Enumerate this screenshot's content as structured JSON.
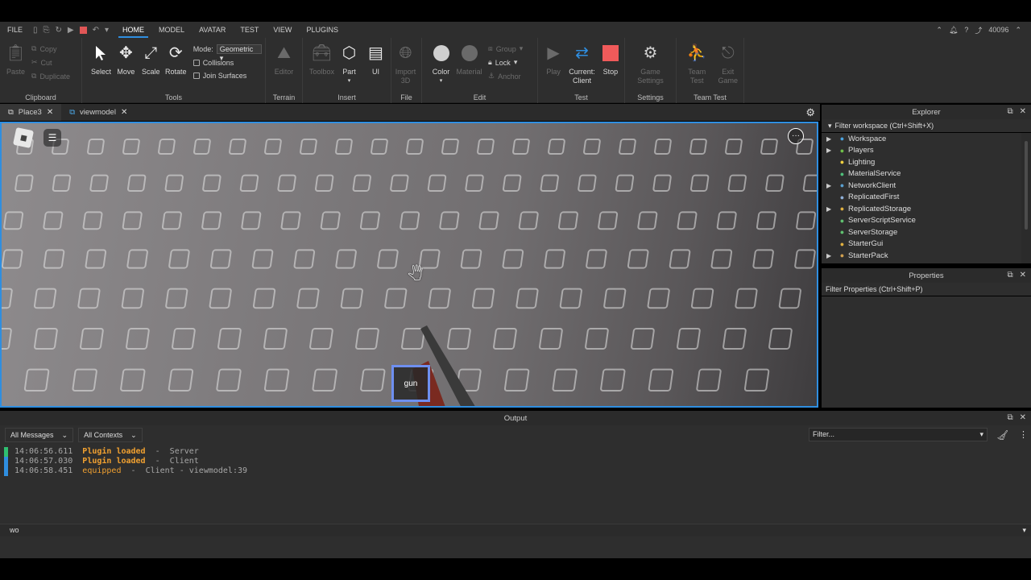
{
  "menubar": {
    "items": [
      "FILE",
      "HOME",
      "MODEL",
      "AVATAR",
      "TEST",
      "VIEW",
      "PLUGINS"
    ],
    "active": "HOME",
    "right_value": "40096"
  },
  "ribbon": {
    "clipboard": {
      "label": "Clipboard",
      "paste": "Paste",
      "copy": "Copy",
      "cut": "Cut",
      "duplicate": "Duplicate"
    },
    "tools": {
      "label": "Tools",
      "select": "Select",
      "move": "Move",
      "scale": "Scale",
      "rotate": "Rotate",
      "mode_label": "Mode:",
      "mode_value": "Geometric",
      "collisions": "Collisions",
      "join_surfaces": "Join Surfaces"
    },
    "terrain": {
      "label": "Terrain",
      "editor": "Editor"
    },
    "insert": {
      "label": "Insert",
      "toolbox": "Toolbox",
      "part": "Part",
      "ui": "UI"
    },
    "file": {
      "label": "File",
      "import3d": "Import 3D"
    },
    "edit": {
      "label": "Edit",
      "color": "Color",
      "material": "Material",
      "group": "Group",
      "lock": "Lock",
      "anchor": "Anchor"
    },
    "test": {
      "label": "Test",
      "play": "Play",
      "current_client": "Current: Client",
      "stop": "Stop"
    },
    "settings": {
      "label": "Settings",
      "game_settings": "Game Settings"
    },
    "team_test": {
      "label": "Team Test",
      "team_test": "Team Test",
      "exit_game": "Exit Game"
    }
  },
  "tabs": [
    {
      "label": "Place3",
      "active": true
    },
    {
      "label": "viewmodel",
      "active": false
    }
  ],
  "viewport": {
    "hotbar_label": "gun"
  },
  "explorer": {
    "title": "Explorer",
    "filter": "Filter workspace (Ctrl+Shift+X)",
    "items": [
      {
        "label": "Workspace",
        "expandable": true,
        "icon": "globe-icon",
        "color": "#4aa3e0"
      },
      {
        "label": "Players",
        "expandable": true,
        "icon": "players-icon",
        "color": "#6fbf4a"
      },
      {
        "label": "Lighting",
        "expandable": false,
        "icon": "bulb-icon",
        "color": "#f0d040"
      },
      {
        "label": "MaterialService",
        "expandable": false,
        "icon": "material-icon",
        "color": "#4fbf7a"
      },
      {
        "label": "NetworkClient",
        "expandable": true,
        "icon": "network-icon",
        "color": "#5aa0d0"
      },
      {
        "label": "ReplicatedFirst",
        "expandable": false,
        "icon": "replicated-icon",
        "color": "#8fb0d8"
      },
      {
        "label": "ReplicatedStorage",
        "expandable": true,
        "icon": "storage-icon",
        "color": "#e0b040"
      },
      {
        "label": "ServerScriptService",
        "expandable": false,
        "icon": "script-service-icon",
        "color": "#60c070"
      },
      {
        "label": "ServerStorage",
        "expandable": false,
        "icon": "server-storage-icon",
        "color": "#60c070"
      },
      {
        "label": "StarterGui",
        "expandable": false,
        "icon": "gui-icon",
        "color": "#e0b040"
      },
      {
        "label": "StarterPack",
        "expandable": true,
        "icon": "pack-icon",
        "color": "#d0a050"
      }
    ]
  },
  "properties": {
    "title": "Properties",
    "filter": "Filter Properties (Ctrl+Shift+P)"
  },
  "output": {
    "title": "Output",
    "messages_filter": "All Messages",
    "contexts_filter": "All Contexts",
    "filter_placeholder": "Filter...",
    "lines": [
      {
        "time": "14:06:56.611",
        "message": "Plugin loaded",
        "tail": "  -  Server",
        "bar_color": "#2fbf71"
      },
      {
        "time": "14:06:57.030",
        "message": "Plugin loaded",
        "tail": "  -  Client",
        "bar_color": "#2f8ee0"
      },
      {
        "time": "14:06:58.451",
        "message": "equipped",
        "tail": "  -  Client - viewmodel:39",
        "bar_color": "#2f8ee0"
      }
    ]
  },
  "command_bar": {
    "value": "wo"
  }
}
